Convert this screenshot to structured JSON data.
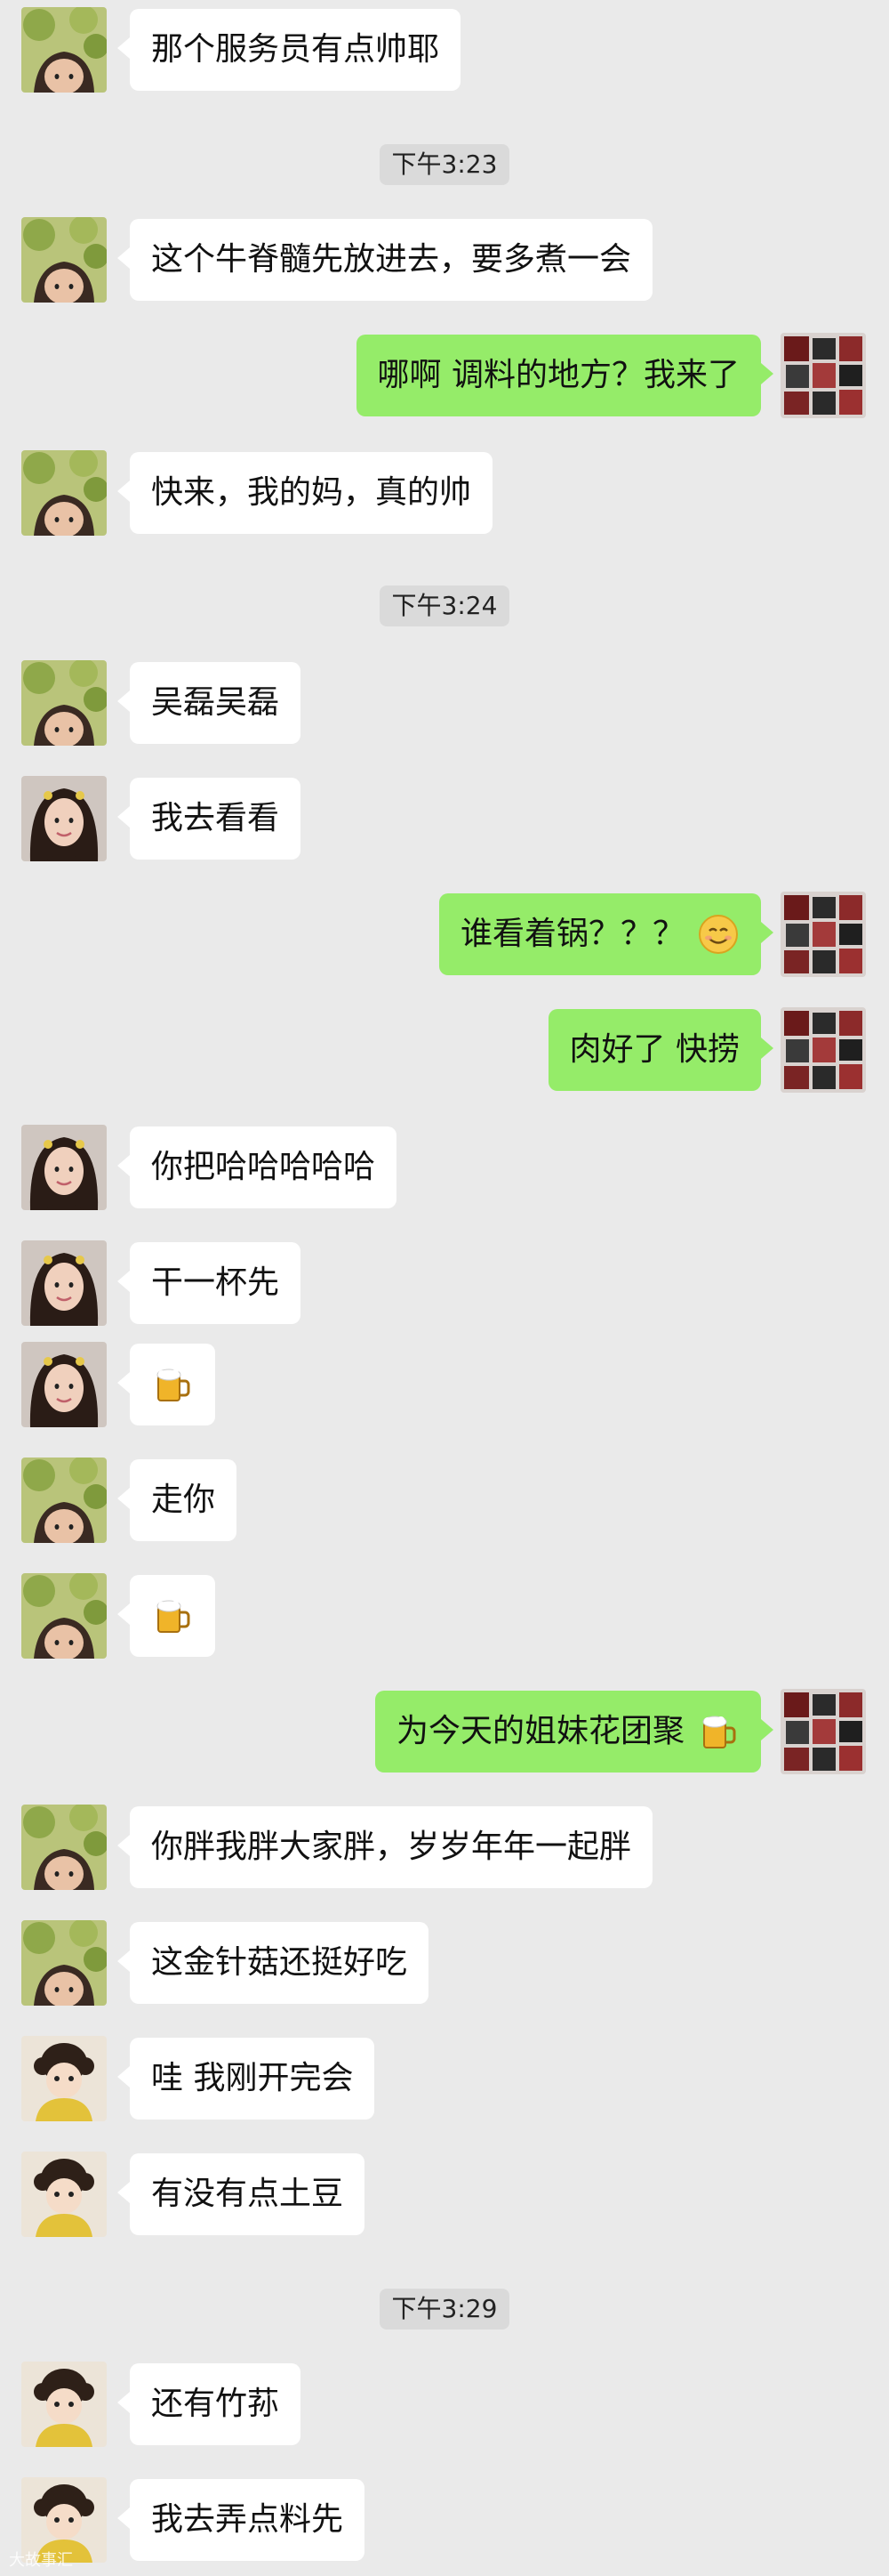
{
  "chat": {
    "times": [
      "下午3:23",
      "下午3:24",
      "下午3:29"
    ],
    "messages": [
      {
        "side": "left",
        "avatar": "girl-green-leaves-avatar",
        "text": "那个服务员有点帅耶"
      },
      {
        "side": "left",
        "avatar": "girl-green-leaves-avatar",
        "text": "这个牛脊髓先放进去，要多煮一会"
      },
      {
        "side": "right",
        "avatar": "collage-red-photo-avatar",
        "text": "哪啊 调料的地方？我来了"
      },
      {
        "side": "left",
        "avatar": "girl-green-leaves-avatar",
        "text": "快来，我的妈，真的帅"
      },
      {
        "side": "left",
        "avatar": "girl-green-leaves-avatar",
        "text": "吴磊吴磊"
      },
      {
        "side": "left",
        "avatar": "long-hair-woman-avatar",
        "text": "我去看看"
      },
      {
        "side": "right",
        "avatar": "collage-red-photo-avatar",
        "text": "谁看着锅？？？",
        "emoji": "smile-emoji"
      },
      {
        "side": "right",
        "avatar": "collage-red-photo-avatar",
        "text": "肉好了 快捞"
      },
      {
        "side": "left",
        "avatar": "long-hair-woman-avatar",
        "text": "你把哈哈哈哈哈"
      },
      {
        "side": "left",
        "avatar": "long-hair-woman-avatar",
        "text": "干一杯先"
      },
      {
        "side": "left",
        "avatar": "long-hair-woman-avatar",
        "text": "",
        "emoji": "beer-emoji"
      },
      {
        "side": "left",
        "avatar": "girl-green-leaves-avatar",
        "text": "走你"
      },
      {
        "side": "left",
        "avatar": "girl-green-leaves-avatar",
        "text": "",
        "emoji": "beer-emoji"
      },
      {
        "side": "right",
        "avatar": "collage-red-photo-avatar",
        "text": "为今天的姐妹花团聚",
        "emoji": "beer-emoji"
      },
      {
        "side": "left",
        "avatar": "girl-green-leaves-avatar",
        "text": "你胖我胖大家胖，岁岁年年一起胖"
      },
      {
        "side": "left",
        "avatar": "girl-green-leaves-avatar",
        "text": "这金针菇还挺好吃"
      },
      {
        "side": "left",
        "avatar": "baby-yellow-sweater-avatar",
        "text": "哇 我刚开完会"
      },
      {
        "side": "left",
        "avatar": "baby-yellow-sweater-avatar",
        "text": "有没有点土豆"
      },
      {
        "side": "left",
        "avatar": "baby-yellow-sweater-avatar",
        "text": "还有竹荪"
      },
      {
        "side": "left",
        "avatar": "baby-yellow-sweater-avatar",
        "text": "我去弄点料先"
      }
    ]
  },
  "watermark": "大故事汇",
  "colors": {
    "background": "#eaeaea",
    "bubble_sent": "#95ec69",
    "bubble_received": "#ffffff",
    "time_chip": "#dadada"
  }
}
